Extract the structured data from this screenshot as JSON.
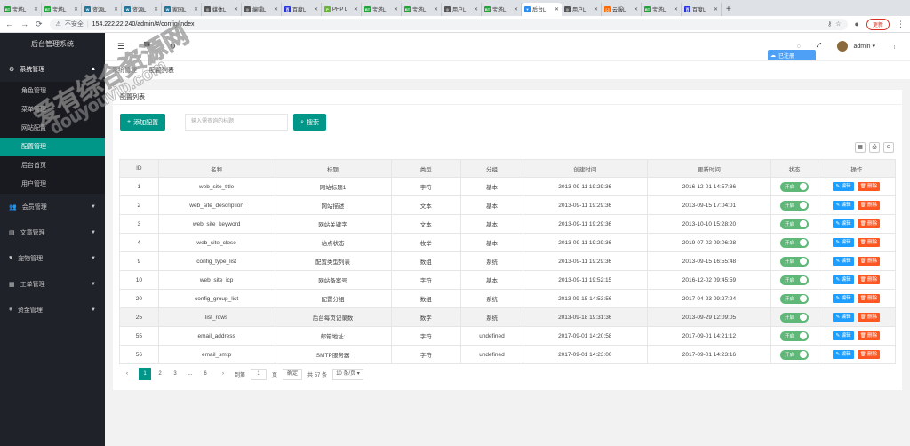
{
  "browser": {
    "tabs": [
      {
        "label": "宝塔L",
        "fav": "BT",
        "color": "#20a53a"
      },
      {
        "label": "宝塔L",
        "fav": "BT",
        "color": "#20a53a"
      },
      {
        "label": "资源L",
        "fav": "W",
        "color": "#21759b"
      },
      {
        "label": "资源L",
        "fav": "W",
        "color": "#21759b"
      },
      {
        "label": "家园L",
        "fav": "W",
        "color": "#21759b"
      },
      {
        "label": "媒体L",
        "fav": "◎",
        "color": "#555"
      },
      {
        "label": "编辑L",
        "fav": "◎",
        "color": "#555"
      },
      {
        "label": "百度L",
        "fav": "百",
        "color": "#2932e1"
      },
      {
        "label": "PHP L",
        "fav": "P",
        "color": "#6cb33e"
      },
      {
        "label": "宝塔L",
        "fav": "BT",
        "color": "#20a53a"
      },
      {
        "label": "宝塔L",
        "fav": "BT",
        "color": "#20a53a"
      },
      {
        "label": "用户L",
        "fav": "◎",
        "color": "#555"
      },
      {
        "label": "宝塔L",
        "fav": "BT",
        "color": "#20a53a"
      },
      {
        "label": "后台L",
        "fav": "▼",
        "color": "#2c8cf0",
        "active": true
      },
      {
        "label": "用户L",
        "fav": "◎",
        "color": "#555"
      },
      {
        "label": "云服L",
        "fav": "[-]",
        "color": "#ff6a00"
      },
      {
        "label": "宝塔L",
        "fav": "BT",
        "color": "#20a53a"
      },
      {
        "label": "百度L",
        "fav": "百",
        "color": "#2932e1"
      }
    ],
    "insecure": "不安全",
    "url": "154.222.22.240/admin/#/config/index",
    "update_label": "更新"
  },
  "sidebar": {
    "title": "后台管理系统",
    "menus": [
      {
        "label": "系统管理",
        "icon": "⚙",
        "open": true,
        "items": [
          {
            "label": "角色管理"
          },
          {
            "label": "菜单管理"
          },
          {
            "label": "网站配置"
          },
          {
            "label": "配置管理",
            "active": true
          },
          {
            "label": "后台首页"
          },
          {
            "label": "用户管理"
          }
        ]
      },
      {
        "label": "会员管理",
        "icon": "👥"
      },
      {
        "label": "文章管理",
        "icon": "▤"
      },
      {
        "label": "宠物管理",
        "icon": "♥"
      },
      {
        "label": "工单管理",
        "icon": "▦"
      },
      {
        "label": "资金管理",
        "icon": "¥"
      }
    ]
  },
  "topbar": {
    "user": "admin"
  },
  "popup": {
    "label": "已注册"
  },
  "breadcrumb": {
    "parent": "系统管理",
    "sep": "/",
    "current": "配置列表"
  },
  "panel": {
    "title": "配置列表",
    "add_label": "添加配置",
    "search_placeholder": "输入需查询的标题",
    "search_label": "搜索"
  },
  "table": {
    "headers": [
      "ID",
      "名称",
      "标题",
      "类型",
      "分组",
      "创建时间",
      "更新时间",
      "状态",
      "操作"
    ],
    "rows": [
      [
        "1",
        "web_site_title",
        "网站标题1",
        "字符",
        "基本",
        "2013-09-11 19:29:36",
        "2016-12-01 14:57:36"
      ],
      [
        "2",
        "web_site_description",
        "网站描述",
        "文本",
        "基本",
        "2013-09-11 19:29:36",
        "2013-09-15 17:04:01"
      ],
      [
        "3",
        "web_site_keyword",
        "网站关键字",
        "文本",
        "基本",
        "2013-09-11 19:29:36",
        "2013-10-10 15:28:20"
      ],
      [
        "4",
        "web_site_close",
        "站点状态",
        "枚举",
        "基本",
        "2013-09-11 19:29:36",
        "2019-07-02 09:06:28"
      ],
      [
        "9",
        "config_type_list",
        "配置类型列表",
        "数组",
        "系统",
        "2013-09-11 19:29:36",
        "2013-09-15 16:55:48"
      ],
      [
        "10",
        "web_site_icp",
        "网站备案号",
        "字符",
        "基本",
        "2013-09-11 19:52:15",
        "2016-12-02 09:45:59"
      ],
      [
        "20",
        "config_group_list",
        "配置分组",
        "数组",
        "系统",
        "2013-09-15 14:53:56",
        "2017-04-23 09:27:24"
      ],
      [
        "25",
        "list_rows",
        "后台每页记录数",
        "数字",
        "系统",
        "2013-09-18 19:31:36",
        "2013-09-29 12:09:05"
      ],
      [
        "55",
        "email_address",
        "邮箱地址:",
        "字符",
        "undefined",
        "2017-09-01 14:20:58",
        "2017-09-01 14:21:12"
      ],
      [
        "56",
        "email_smtp",
        "SMTP服务器",
        "字符",
        "undefined",
        "2017-09-01 14:23:00",
        "2017-09-01 14:23:16"
      ]
    ],
    "highlight_row": 7,
    "status_label": "开启",
    "edit_label": "编辑",
    "delete_label": "删除"
  },
  "pager": {
    "pages": [
      "1",
      "2",
      "3",
      "...",
      "6"
    ],
    "current": "1",
    "goto_label": "到第",
    "goto_value": "1",
    "page_unit": "页",
    "confirm_label": "确定",
    "total": "共 57 条",
    "per_page": "10 条/页"
  },
  "watermark": {
    "line1": "爱有综合资源网",
    "line2": "douyouvip.com"
  }
}
